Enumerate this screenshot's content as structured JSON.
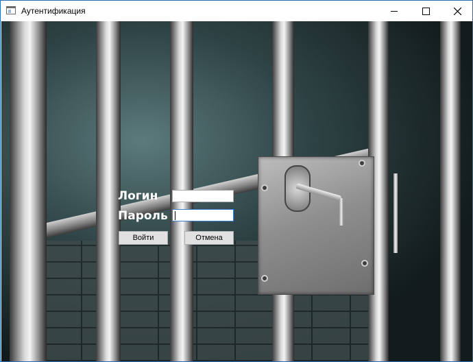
{
  "window": {
    "title": "Аутентификация",
    "icon": "app-window-icon"
  },
  "form": {
    "login_label": "Логин",
    "password_label": "Пароль",
    "login_value": "",
    "password_value": "",
    "login_button": "Войти",
    "cancel_button": "Отмена"
  }
}
